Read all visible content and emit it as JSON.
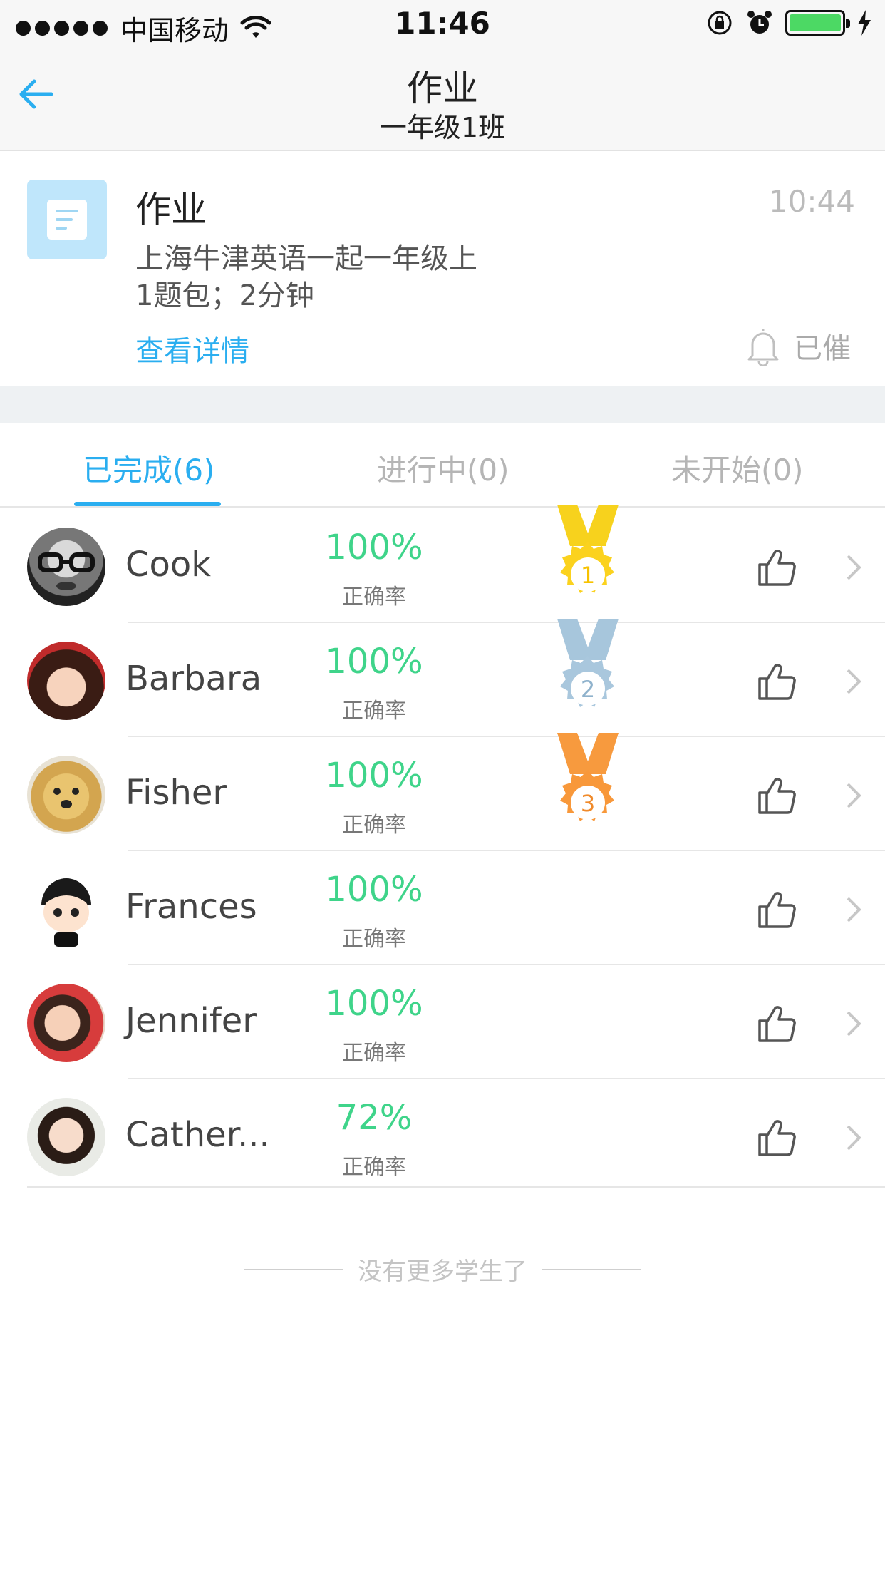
{
  "status_bar": {
    "carrier": "中国移动",
    "time": "11:46",
    "battery_color": "#4cd964"
  },
  "nav": {
    "back_icon": "arrow-left-icon",
    "title": "作业",
    "subtitle": "一年级1班"
  },
  "homework": {
    "icon": "document-icon",
    "title": "作业",
    "time": "10:44",
    "description": "上海牛津英语一起一年级上",
    "meta": "1题包；2分钟",
    "detail_link": "查看详情",
    "remind_icon": "bell-icon",
    "remind_status": "已催"
  },
  "tabs": [
    {
      "label": "已完成(6)",
      "active": true
    },
    {
      "label": "进行中(0)",
      "active": false
    },
    {
      "label": "未开始(0)",
      "active": false
    }
  ],
  "accent_color": "#2aaef0",
  "accuracy_color": "#3fd48a",
  "students": [
    {
      "name": "Cook",
      "accuracy": "100%",
      "accuracy_label": "正确率",
      "medal": "1",
      "medal_color": "#f7d21d"
    },
    {
      "name": "Barbara",
      "accuracy": "100%",
      "accuracy_label": "正确率",
      "medal": "2",
      "medal_color": "#a7c6dc"
    },
    {
      "name": "Fisher",
      "accuracy": "100%",
      "accuracy_label": "正确率",
      "medal": "3",
      "medal_color": "#f79a3e"
    },
    {
      "name": "Frances",
      "accuracy": "100%",
      "accuracy_label": "正确率",
      "medal": null
    },
    {
      "name": "Jennifer",
      "accuracy": "100%",
      "accuracy_label": "正确率",
      "medal": null
    },
    {
      "name": "Cather...",
      "accuracy": "72%",
      "accuracy_label": "正确率",
      "medal": null
    }
  ],
  "footer": {
    "no_more": "没有更多学生了"
  }
}
